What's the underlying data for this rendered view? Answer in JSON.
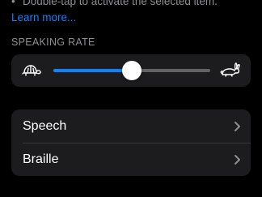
{
  "hint": {
    "bullet": "•",
    "text": "Double-tap to activate the selected item."
  },
  "learn_more_label": "Learn more...",
  "speaking_rate": {
    "header": "SPEAKING RATE",
    "slow_icon": "turtle-icon",
    "fast_icon": "rabbit-icon",
    "value_fraction": 0.5
  },
  "menu": {
    "items": [
      {
        "label": "Speech",
        "icon": "chevron-right-icon"
      },
      {
        "label": "Braille",
        "icon": "chevron-right-icon"
      }
    ]
  },
  "colors": {
    "background": "#000000",
    "card": "#1c1c1e",
    "accent": "#0a84ff",
    "secondary_text": "#8e8e93",
    "track": "#636366"
  }
}
